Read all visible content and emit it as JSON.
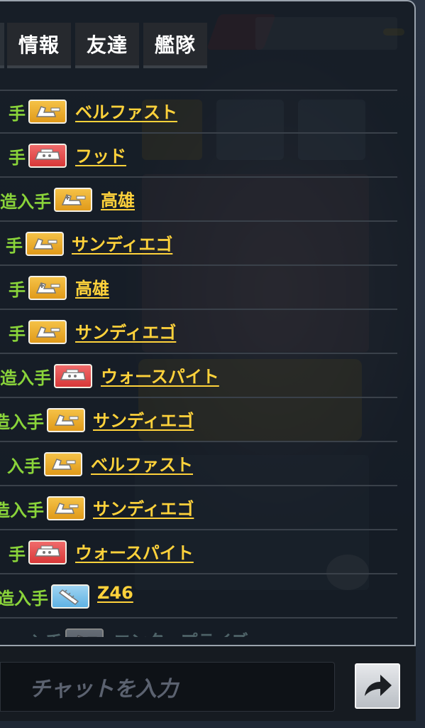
{
  "tabs": [
    {
      "label": "情報"
    },
    {
      "label": "友達"
    },
    {
      "label": "艦隊"
    }
  ],
  "feed": [
    {
      "prefix": "手",
      "badge": "gold",
      "badge_icon": "destroyer-icon",
      "ship": "ベルファスト"
    },
    {
      "prefix": "手",
      "badge": "red",
      "badge_icon": "battleship-icon",
      "ship": "フッド"
    },
    {
      "prefix": "造入手",
      "badge": "gold",
      "badge_icon": "heavy-cruiser-icon",
      "ship": "高雄"
    },
    {
      "prefix": "手",
      "badge": "gold",
      "badge_icon": "destroyer-icon",
      "ship": "サンディエゴ"
    },
    {
      "prefix": "手",
      "badge": "gold",
      "badge_icon": "heavy-cruiser-icon",
      "ship": "高雄"
    },
    {
      "prefix": "手",
      "badge": "gold",
      "badge_icon": "destroyer-icon",
      "ship": "サンディエゴ"
    },
    {
      "prefix": "造入手",
      "badge": "red",
      "badge_icon": "battleship-icon",
      "ship": "ウォースパイト"
    },
    {
      "prefix": "造入手",
      "badge": "gold",
      "badge_icon": "destroyer-icon",
      "ship": "サンディエゴ"
    },
    {
      "prefix": "入手",
      "badge": "gold",
      "badge_icon": "destroyer-icon",
      "ship": "ベルファスト"
    },
    {
      "prefix": "造入手",
      "badge": "gold",
      "badge_icon": "destroyer-icon",
      "ship": "サンディエゴ"
    },
    {
      "prefix": "手",
      "badge": "red",
      "badge_icon": "battleship-icon",
      "ship": "ウォースパイト"
    },
    {
      "prefix": "造入手",
      "badge": "blue",
      "badge_icon": "torpedo-icon",
      "ship": "Z46"
    },
    {
      "prefix": "入手",
      "badge": "grey",
      "badge_icon": "destroyer-icon",
      "ship": "エンタープライズ"
    }
  ],
  "chat": {
    "placeholder": "チャットを入力",
    "send_icon": "arrow-right-icon"
  },
  "colors": {
    "prefix_green": "#8ad43a",
    "ship_link_gold": "#ffd23b",
    "badge_gold": "#e09a1a",
    "badge_red": "#d83838",
    "badge_blue": "#5fb2e3"
  }
}
